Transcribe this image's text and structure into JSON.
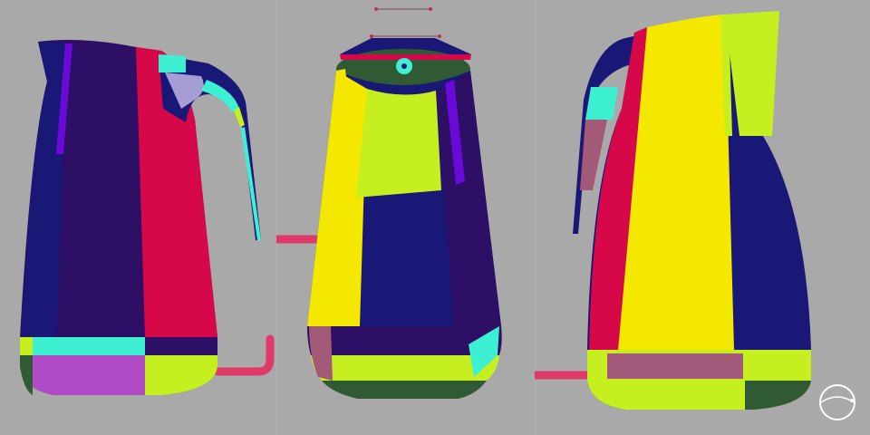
{
  "app": {
    "title": "",
    "background": "#a9a9a9"
  },
  "viewports": [
    {
      "id": "left",
      "view": "side-left"
    },
    {
      "id": "middle",
      "view": "front"
    },
    {
      "id": "right",
      "view": "side-right"
    }
  ],
  "palette": {
    "navy": "#1a1876",
    "indigo": "#2d0f66",
    "violet": "#6a0ad8",
    "crimson": "#d6084a",
    "yellow": "#f4e800",
    "lime": "#c6ef20",
    "aqua": "#3ef0d2",
    "lavender": "#a49ed4",
    "magenta": "#b24bc8",
    "mauve": "#a25a78",
    "darkgreen": "#2f5a34",
    "pipe": "#e03a6a"
  },
  "icons": {
    "view_cube": "view-cube-icon",
    "origin": "origin-marker-icon"
  }
}
